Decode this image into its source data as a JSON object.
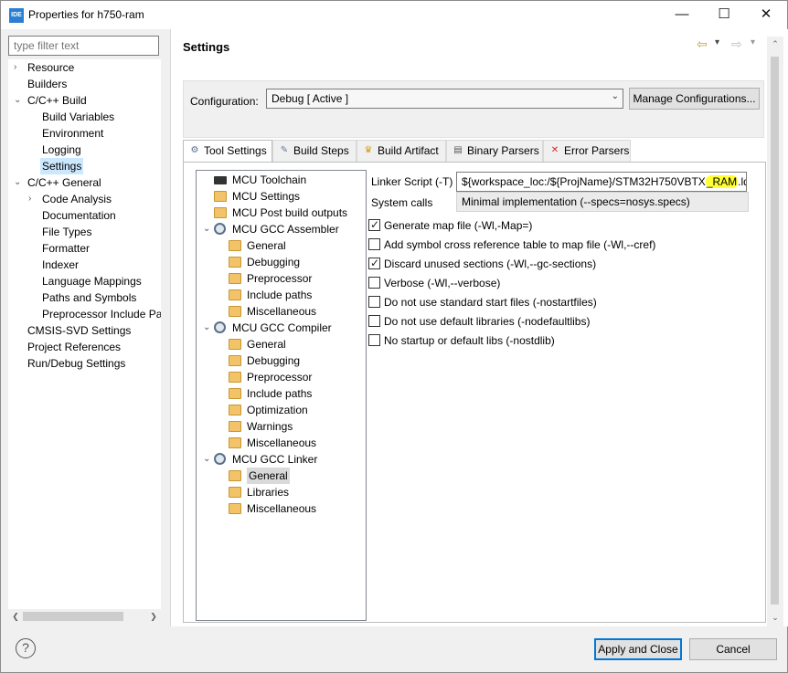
{
  "window": {
    "app_icon": "IDE",
    "title": "Properties for h750-ram",
    "minimize": "—",
    "maximize": "☐",
    "close": "✕"
  },
  "filter": {
    "placeholder": "type filter text"
  },
  "left_tree": [
    {
      "label": "Resource",
      "chev": "›",
      "indent": 0
    },
    {
      "label": "Builders",
      "chev": "",
      "indent": 0
    },
    {
      "label": "C/C++ Build",
      "chev": "⌄",
      "indent": 0
    },
    {
      "label": "Build Variables",
      "chev": "",
      "indent": 1
    },
    {
      "label": "Environment",
      "chev": "",
      "indent": 1
    },
    {
      "label": "Logging",
      "chev": "",
      "indent": 1
    },
    {
      "label": "Settings",
      "chev": "",
      "indent": 1,
      "selected": true
    },
    {
      "label": "C/C++ General",
      "chev": "⌄",
      "indent": 0
    },
    {
      "label": "Code Analysis",
      "chev": "›",
      "indent": 1
    },
    {
      "label": "Documentation",
      "chev": "",
      "indent": 1
    },
    {
      "label": "File Types",
      "chev": "",
      "indent": 1
    },
    {
      "label": "Formatter",
      "chev": "",
      "indent": 1
    },
    {
      "label": "Indexer",
      "chev": "",
      "indent": 1
    },
    {
      "label": "Language Mappings",
      "chev": "",
      "indent": 1
    },
    {
      "label": "Paths and Symbols",
      "chev": "",
      "indent": 1
    },
    {
      "label": "Preprocessor Include Pat",
      "chev": "",
      "indent": 1
    },
    {
      "label": "CMSIS-SVD Settings",
      "chev": "",
      "indent": 0
    },
    {
      "label": "Project References",
      "chev": "",
      "indent": 0
    },
    {
      "label": "Run/Debug Settings",
      "chev": "",
      "indent": 0
    }
  ],
  "page": {
    "title": "Settings",
    "back_icon": "⇦",
    "forward_icon": "⇨",
    "menu_icon": "▾"
  },
  "configuration": {
    "label": "Configuration:",
    "value": "Debug  [ Active ]",
    "manage_button": "Manage Configurations..."
  },
  "tabs": [
    {
      "label": "Tool Settings",
      "icon": "tool-settings-icon",
      "glyph": "⚙",
      "color": "#5a6f87",
      "active": true
    },
    {
      "label": "Build Steps",
      "icon": "build-steps-icon",
      "glyph": "✎",
      "color": "#6a7a9a"
    },
    {
      "label": "Build Artifact",
      "icon": "trophy-icon",
      "glyph": "♛",
      "color": "#d4a017"
    },
    {
      "label": "Binary Parsers",
      "icon": "binary-icon",
      "glyph": "▤",
      "color": "#555555"
    },
    {
      "label": "Error Parsers",
      "icon": "error-icon",
      "glyph": "✕",
      "color": "#e02020"
    }
  ],
  "tool_tree": [
    {
      "label": "MCU Toolchain",
      "type": "chip",
      "indent": 0
    },
    {
      "label": "MCU Settings",
      "type": "gear-folder",
      "indent": 0
    },
    {
      "label": "MCU Post build outputs",
      "type": "gear-folder",
      "indent": 0
    },
    {
      "label": "MCU GCC Assembler",
      "type": "gear",
      "indent": 0,
      "expanded": true
    },
    {
      "label": "General",
      "type": "folder",
      "indent": 1
    },
    {
      "label": "Debugging",
      "type": "folder",
      "indent": 1
    },
    {
      "label": "Preprocessor",
      "type": "folder",
      "indent": 1
    },
    {
      "label": "Include paths",
      "type": "folder",
      "indent": 1
    },
    {
      "label": "Miscellaneous",
      "type": "folder",
      "indent": 1
    },
    {
      "label": "MCU GCC Compiler",
      "type": "gear",
      "indent": 0,
      "expanded": true
    },
    {
      "label": "General",
      "type": "folder",
      "indent": 1
    },
    {
      "label": "Debugging",
      "type": "folder",
      "indent": 1
    },
    {
      "label": "Preprocessor",
      "type": "folder",
      "indent": 1
    },
    {
      "label": "Include paths",
      "type": "folder",
      "indent": 1
    },
    {
      "label": "Optimization",
      "type": "folder",
      "indent": 1
    },
    {
      "label": "Warnings",
      "type": "folder",
      "indent": 1
    },
    {
      "label": "Miscellaneous",
      "type": "folder",
      "indent": 1
    },
    {
      "label": "MCU GCC Linker",
      "type": "gear",
      "indent": 0,
      "expanded": true
    },
    {
      "label": "General",
      "type": "folder",
      "indent": 1,
      "selected": true
    },
    {
      "label": "Libraries",
      "type": "folder",
      "indent": 1
    },
    {
      "label": "Miscellaneous",
      "type": "folder",
      "indent": 1
    }
  ],
  "linker": {
    "script_label": "Linker Script (-T)",
    "script_prefix": "${workspace_loc:/${ProjName}/STM32H750VBTX",
    "script_highlight": "_RAM",
    "script_suffix": ".ld}",
    "syscalls_label": "System calls",
    "syscalls_value": "Minimal implementation (--specs=nosys.specs)"
  },
  "options": [
    {
      "label": "Generate map file (-Wl,-Map=)",
      "checked": true
    },
    {
      "label": "Add symbol cross reference table to map file (-Wl,--cref)",
      "checked": false
    },
    {
      "label": "Discard unused sections (-Wl,--gc-sections)",
      "checked": true
    },
    {
      "label": "Verbose (-Wl,--verbose)",
      "checked": false
    },
    {
      "label": "Do not use standard start files (-nostartfiles)",
      "checked": false
    },
    {
      "label": "Do not use default libraries (-nodefaultlibs)",
      "checked": false
    },
    {
      "label": "No startup or default libs (-nostdlib)",
      "checked": false
    }
  ],
  "footer": {
    "help": "?",
    "apply_close": "Apply and Close",
    "cancel": "Cancel"
  }
}
